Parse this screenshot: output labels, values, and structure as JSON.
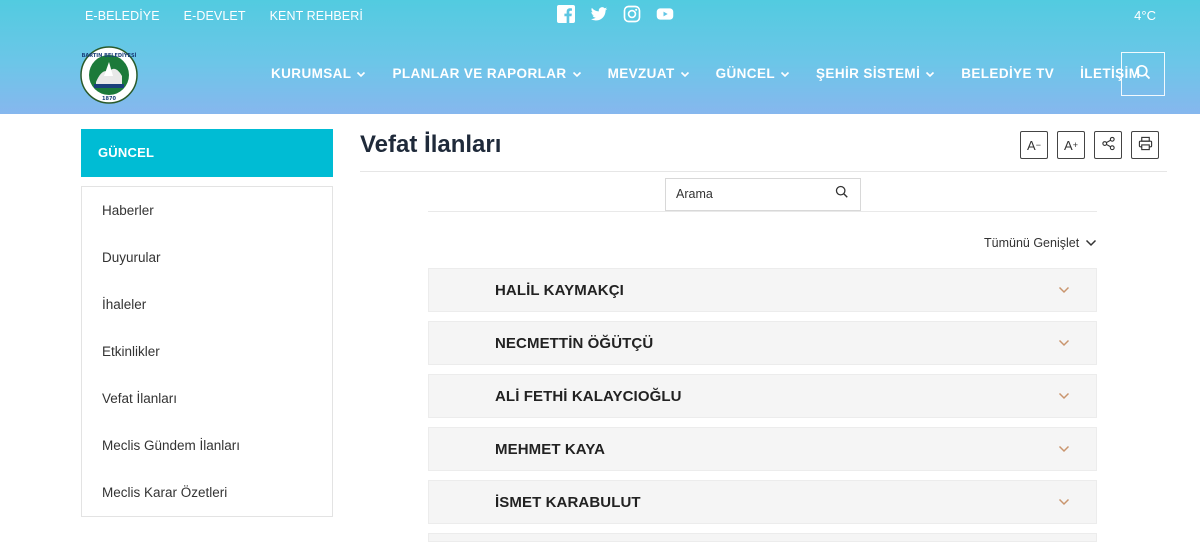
{
  "header": {
    "top_links": [
      "E-BELEDİYE",
      "E-DEVLET",
      "KENT REHBERİ"
    ],
    "socials": [
      "facebook-icon",
      "twitter-icon",
      "instagram-icon",
      "youtube-icon"
    ],
    "temperature": "4°C",
    "nav": [
      {
        "label": "KURUMSAL",
        "dropdown": true
      },
      {
        "label": "PLANLAR VE RAPORLAR",
        "dropdown": true
      },
      {
        "label": "MEVZUAT",
        "dropdown": true
      },
      {
        "label": "GÜNCEL",
        "dropdown": true
      },
      {
        "label": "ŞEHİR SİSTEMİ",
        "dropdown": true
      },
      {
        "label": "BELEDİYE TV",
        "dropdown": false
      },
      {
        "label": "İLETİŞİM",
        "dropdown": false
      }
    ],
    "logo_text": "BARTIN BELEDİYESİ",
    "logo_year": "1870"
  },
  "sidebar": {
    "title": "GÜNCEL",
    "items": [
      {
        "label": "Haberler"
      },
      {
        "label": "Duyurular"
      },
      {
        "label": "İhaleler"
      },
      {
        "label": "Etkinlikler"
      },
      {
        "label": "Vefat İlanları"
      },
      {
        "label": "Meclis Gündem İlanları"
      },
      {
        "label": "Meclis Karar Özetleri"
      }
    ]
  },
  "content": {
    "title": "Vefat İlanları",
    "tools": {
      "font_decrease": "A",
      "font_increase": "A"
    },
    "search": {
      "placeholder": "Arama",
      "value": ""
    },
    "expand_all": "Tümünü Genişlet",
    "announcements": [
      {
        "name": "HALİL KAYMAKÇI"
      },
      {
        "name": "NECMETTİN ÖĞÜTÇÜ"
      },
      {
        "name": "ALİ FETHİ KALAYCIOĞLU"
      },
      {
        "name": "MEHMET KAYA"
      },
      {
        "name": "İSMET KARABULUT"
      }
    ]
  },
  "colors": {
    "header_start": "#52cbe0",
    "header_end": "#86b7ee",
    "accent": "#00bcd4",
    "chevron": "#c9956e"
  }
}
